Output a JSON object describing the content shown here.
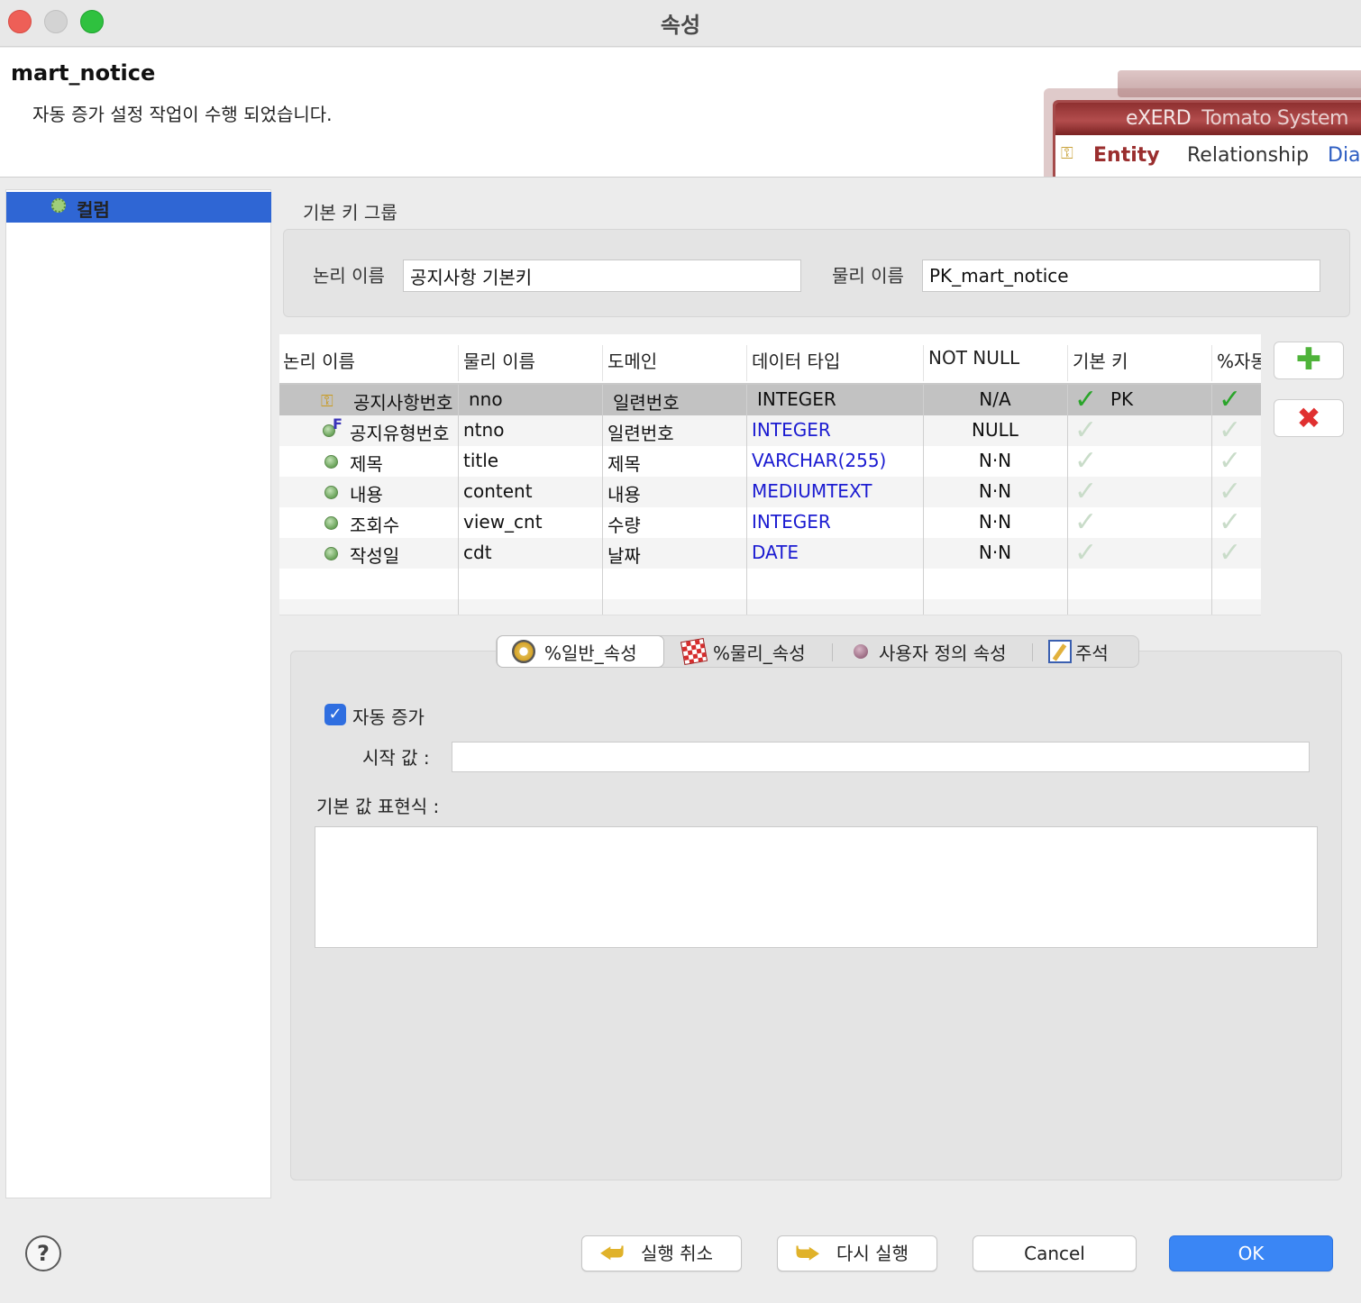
{
  "window": {
    "title": "속성"
  },
  "header": {
    "title": "mart_notice",
    "message": "자동 증가 설정 작업이 수행 되었습니다.",
    "banner": {
      "brand": "eXERD",
      "system": "Tomato System",
      "tabs": [
        "Entity",
        "Relationship",
        "Diag"
      ]
    }
  },
  "tree": {
    "items": [
      {
        "label": "컬럼",
        "icon": "gear-icon"
      }
    ]
  },
  "primary_key_group": {
    "legend": "기본 키 그룹",
    "logical_name_label": "논리 이름",
    "logical_name_value": "공지사항 기본키",
    "physical_name_label": "물리 이름",
    "physical_name_value": "PK_mart_notice"
  },
  "columns_table": {
    "headers": [
      "논리 이름",
      "물리 이름",
      "도메인",
      "데이터 타입",
      "NOT NULL",
      "기본 키",
      "%자동"
    ],
    "rows": [
      {
        "logical": "공지사항번호",
        "physical": "nno",
        "domain": "일련번호",
        "type": "INTEGER",
        "not_null": "N/A",
        "pk": "PK",
        "pk_checked": true,
        "auto_checked": true,
        "icon": "primary-key-icon",
        "selected": true
      },
      {
        "logical": "공지유형번호",
        "physical": "ntno",
        "domain": "일련번호",
        "type": "INTEGER",
        "not_null": "NULL",
        "pk": "",
        "pk_checked": false,
        "auto_checked": false,
        "icon": "foreign-key-icon",
        "selected": false
      },
      {
        "logical": "제목",
        "physical": "title",
        "domain": "제목",
        "type": "VARCHAR(255)",
        "not_null": "N·N",
        "pk": "",
        "pk_checked": false,
        "auto_checked": false,
        "icon": "column-icon",
        "selected": false
      },
      {
        "logical": "내용",
        "physical": "content",
        "domain": "내용",
        "type": "MEDIUMTEXT",
        "not_null": "N·N",
        "pk": "",
        "pk_checked": false,
        "auto_checked": false,
        "icon": "column-icon",
        "selected": false
      },
      {
        "logical": "조회수",
        "physical": "view_cnt",
        "domain": "수량",
        "type": "INTEGER",
        "not_null": "N·N",
        "pk": "",
        "pk_checked": false,
        "auto_checked": false,
        "icon": "column-icon",
        "selected": false
      },
      {
        "logical": "작성일",
        "physical": "cdt",
        "domain": "날짜",
        "type": "DATE",
        "not_null": "N·N",
        "pk": "",
        "pk_checked": false,
        "auto_checked": false,
        "icon": "column-icon",
        "selected": false
      }
    ]
  },
  "tabs": [
    {
      "label": "%일반_속성",
      "icon": "compass-icon",
      "active": true
    },
    {
      "label": "%물리_속성",
      "icon": "physical-icon",
      "active": false
    },
    {
      "label": "사용자 정의 속성",
      "icon": "user-defined-icon",
      "active": false
    },
    {
      "label": "주석",
      "icon": "note-icon",
      "active": false
    }
  ],
  "general": {
    "auto_increment_label": "자동 증가",
    "auto_increment_checked": true,
    "start_value_label": "시작 값 :",
    "start_value": "",
    "default_expr_label": "기본 값 표현식 :",
    "default_expr": ""
  },
  "footer": {
    "help": "?",
    "undo": "실행 취소",
    "redo": "다시 실행",
    "cancel": "Cancel",
    "ok": "OK"
  },
  "colors": {
    "accent": "#2f66d4",
    "ok_button": "#3a86f5",
    "type_text": "#1b1bd1",
    "check": "#2aa52a"
  }
}
